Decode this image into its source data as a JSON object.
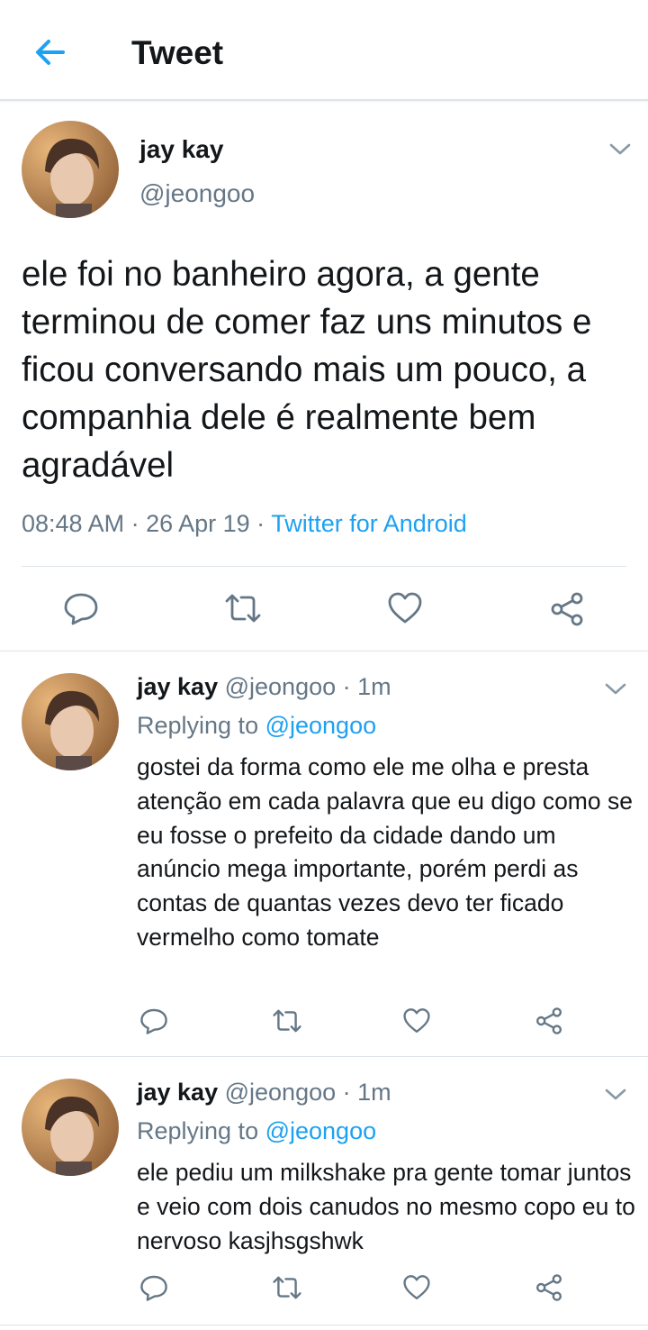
{
  "header": {
    "title": "Tweet"
  },
  "main_tweet": {
    "name": "jay kay",
    "handle": "@jeongoo",
    "text": "ele foi no banheiro agora, a gente terminou de comer faz uns minutos e ficou conversando mais um pouco, a companhia dele é realmente bem agradável",
    "time": "08:48 AM",
    "date": "26 Apr 19",
    "source": "Twitter for Android",
    "separator": " · "
  },
  "replies": [
    {
      "name": "jay kay",
      "handle": "@jeongoo",
      "dot": " · ",
      "time": "1m",
      "replying_prefix": "Replying to ",
      "replying_handle": "@jeongoo",
      "text": "gostei da forma como ele me olha e presta atenção em cada palavra que eu digo como se eu fosse o prefeito da cidade dando um anúncio mega importante, porém perdi as contas de quantas vezes devo ter ficado vermelho como tomate"
    },
    {
      "name": "jay kay",
      "handle": "@jeongoo",
      "dot": " · ",
      "time": "1m",
      "replying_prefix": "Replying to ",
      "replying_handle": "@jeongoo",
      "text": "ele pediu um milkshake pra gente tomar juntos e veio com dois canudos no mesmo copo eu to nervoso kasjhsgshwk"
    }
  ],
  "icons": {
    "back": "arrow-left-icon",
    "reply": "reply-bubble-icon",
    "retweet": "retweet-icon",
    "like": "heart-icon",
    "share": "share-icon",
    "more": "chevron-down-icon"
  },
  "colors": {
    "accent": "#1da1f2",
    "text": "#14171a",
    "secondary": "#657786",
    "divider": "#dde3e8",
    "icon": "#657786"
  }
}
